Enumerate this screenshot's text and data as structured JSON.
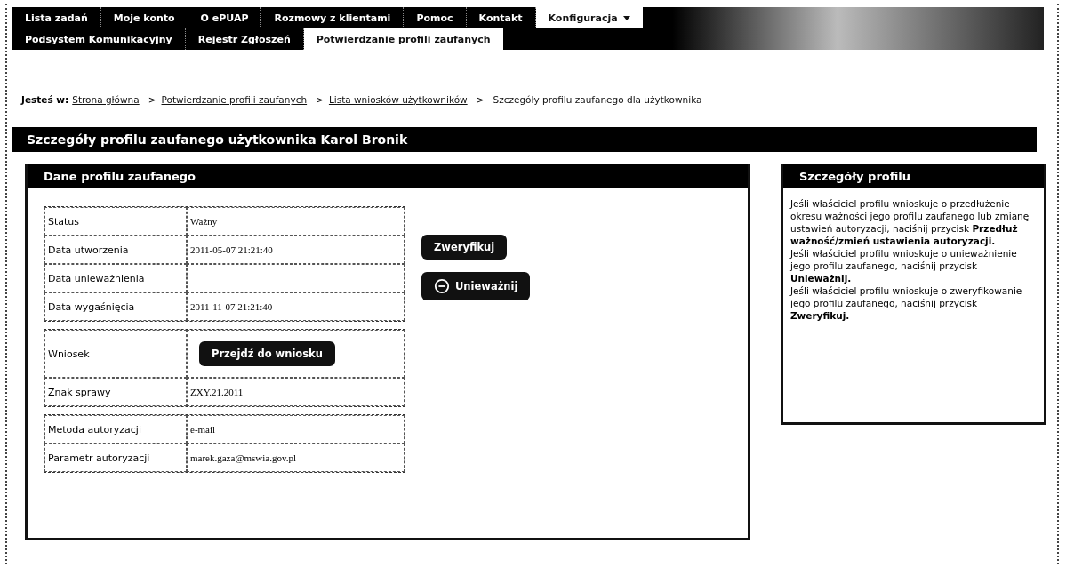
{
  "nav": {
    "primary": [
      {
        "label": "Lista zadań",
        "selected": false
      },
      {
        "label": "Moje konto",
        "selected": false
      },
      {
        "label": "O ePUAP",
        "selected": false
      },
      {
        "label": "Rozmowy z klientami",
        "selected": false
      },
      {
        "label": "Pomoc",
        "selected": false
      },
      {
        "label": "Kontakt",
        "selected": false
      },
      {
        "label": "Konfiguracja",
        "selected": true
      }
    ],
    "secondary": [
      {
        "label": "Podsystem Komunikacyjny",
        "selected": false
      },
      {
        "label": "Rejestr Zgłoszeń",
        "selected": false
      },
      {
        "label": "Potwierdzanie profili zaufanych",
        "selected": true
      }
    ]
  },
  "breadcrumb": {
    "prefix": "Jesteś w:",
    "items": [
      {
        "label": "Strona główna",
        "link": true
      },
      {
        "label": "Potwierdzanie profili zaufanych",
        "link": true
      },
      {
        "label": "Lista wniosków użytkowników",
        "link": true
      },
      {
        "label": "Szczegóły profilu zaufanego dla użytkownika",
        "link": false
      }
    ],
    "separator": ">"
  },
  "page_title": "Szczegóły profilu zaufanego użytkownika Karol Bronik",
  "profile_panel": {
    "title": "Dane profilu zaufanego",
    "groups": [
      [
        {
          "label": "Status",
          "value": "Ważny",
          "kind": "text"
        },
        {
          "label": "Data utworzenia",
          "value": "2011-05-07 21:21:40",
          "kind": "text"
        },
        {
          "label": "Data unieważnienia",
          "kind": "text"
        },
        {
          "label": "Data wygaśnięcia",
          "value": "2011-11-07 21:21:40",
          "kind": "text"
        }
      ],
      [
        {
          "label": "Wniosek",
          "value": "Przejdź do wniosku",
          "kind": "button"
        },
        {
          "label": "Znak sprawy",
          "value": "ZXY.21.2011",
          "kind": "text"
        }
      ],
      [
        {
          "label": "Metoda autoryzacji",
          "value": "e-mail",
          "kind": "text"
        },
        {
          "label": "Parametr autoryzacji",
          "value": "marek.gaza@mswia.gov.pl",
          "kind": "text"
        }
      ]
    ],
    "actions": [
      {
        "label": "Zweryfikuj",
        "kind": "plain"
      },
      {
        "label": "Unieważnij",
        "kind": "revoke"
      }
    ]
  },
  "info_panel": {
    "title": "Szczegóły profilu",
    "paragraphs": [
      "Jeśli właściciel profilu wnioskuje o przedłużenie okresu ważności jego profilu zaufanego lub zmianę ustawień autoryzacji, naciśnij przycisk **Przedłuż ważność/zmień ustawienia autoryzacji.**",
      "Jeśli właściciel profilu wnioskuje o unieważnienie jego profilu zaufanego, naciśnij przycisk **Unieważnij.**",
      "Jeśli właściciel profilu wnioskuje o zweryfikowanie jego profilu zaufanego, naciśnij przycisk **Zweryfikuj.**"
    ]
  }
}
